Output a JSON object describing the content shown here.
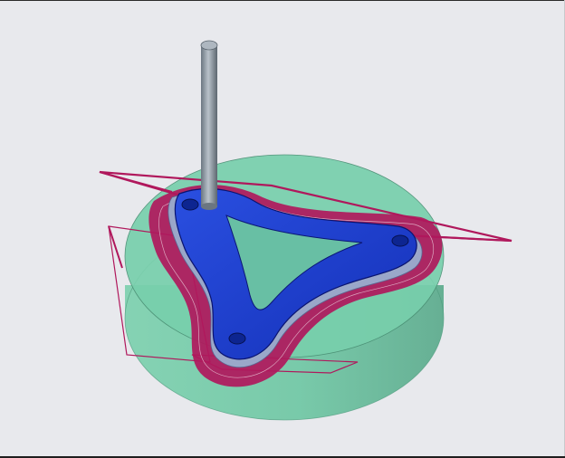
{
  "viewport": {
    "background": "#e8e9ed"
  },
  "scene": {
    "stock": {
      "color": "#6cc6a2",
      "edge": "#4a8f74"
    },
    "part": {
      "color": "#1f3ecf",
      "edge": "#0a1470"
    },
    "toolpath": {
      "color": "#b0185c"
    },
    "tool": {
      "color": "#8f99a3"
    }
  }
}
